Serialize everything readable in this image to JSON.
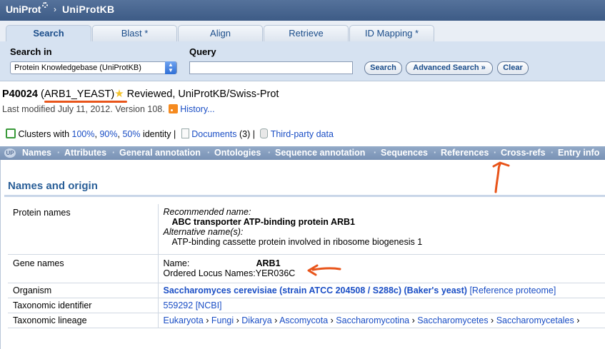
{
  "header": {
    "logo": "UniProt",
    "breadcrumb": "UniProtKB"
  },
  "tabs": [
    {
      "label": "Search",
      "active": true
    },
    {
      "label": "Blast *",
      "active": false
    },
    {
      "label": "Align",
      "active": false
    },
    {
      "label": "Retrieve",
      "active": false
    },
    {
      "label": "ID Mapping *",
      "active": false
    }
  ],
  "search": {
    "search_in_label": "Search in",
    "query_label": "Query",
    "database": "Protein Knowledgebase (UniProtKB)",
    "query_value": "",
    "search_button": "Search",
    "advanced_button": "Advanced Search »",
    "clear_button": "Clear"
  },
  "entry": {
    "accession": "P40024",
    "entry_name": "(ARB1_YEAST)",
    "status": "Reviewed, UniProtKB/Swiss-Prot",
    "modified": "Last modified July 11, 2012. Version 108.",
    "history_link": "History..."
  },
  "tools": {
    "clusters_prefix": "Clusters with",
    "cluster_100": "100%",
    "cluster_90": "90%",
    "cluster_50": "50%",
    "identity_suffix": "identity",
    "documents": "Documents",
    "documents_count": "(3)",
    "third_party": "Third-party data"
  },
  "nav": [
    "Names",
    "Attributes",
    "General annotation",
    "Ontologies",
    "Sequence annotation",
    "Sequences",
    "References",
    "Cross-refs",
    "Entry info"
  ],
  "section": {
    "title": "Names and origin",
    "protein_names_key": "Protein names",
    "recommended_label": "Recommended name:",
    "recommended_value": "ABC transporter ATP-binding protein ARB1",
    "alternative_label": "Alternative name(s):",
    "alternative_value": "ATP-binding cassette protein involved in ribosome biogenesis 1",
    "gene_names_key": "Gene names",
    "gene_name_label": "Name:",
    "gene_name_value": "ARB1",
    "locus_label": "Ordered Locus Names:",
    "locus_value": "YER036C",
    "organism_key": "Organism",
    "organism_value": "Saccharomyces cerevisiae (strain ATCC 204508 / S288c) (Baker's yeast)",
    "reference_proteome": "[Reference proteome]",
    "taxid_key": "Taxonomic identifier",
    "taxid_value": "559292",
    "taxid_ncbi": "[NCBI]",
    "lineage_key": "Taxonomic lineage",
    "lineage": [
      "Eukaryota",
      "Fungi",
      "Dikarya",
      "Ascomycota",
      "Saccharomycotina",
      "Saccharomycetes",
      "Saccharomycetales"
    ]
  },
  "colors": {
    "annotation_red": "#e8541a",
    "link_blue": "#1a4ec5",
    "header_blue": "#3d5b86"
  }
}
